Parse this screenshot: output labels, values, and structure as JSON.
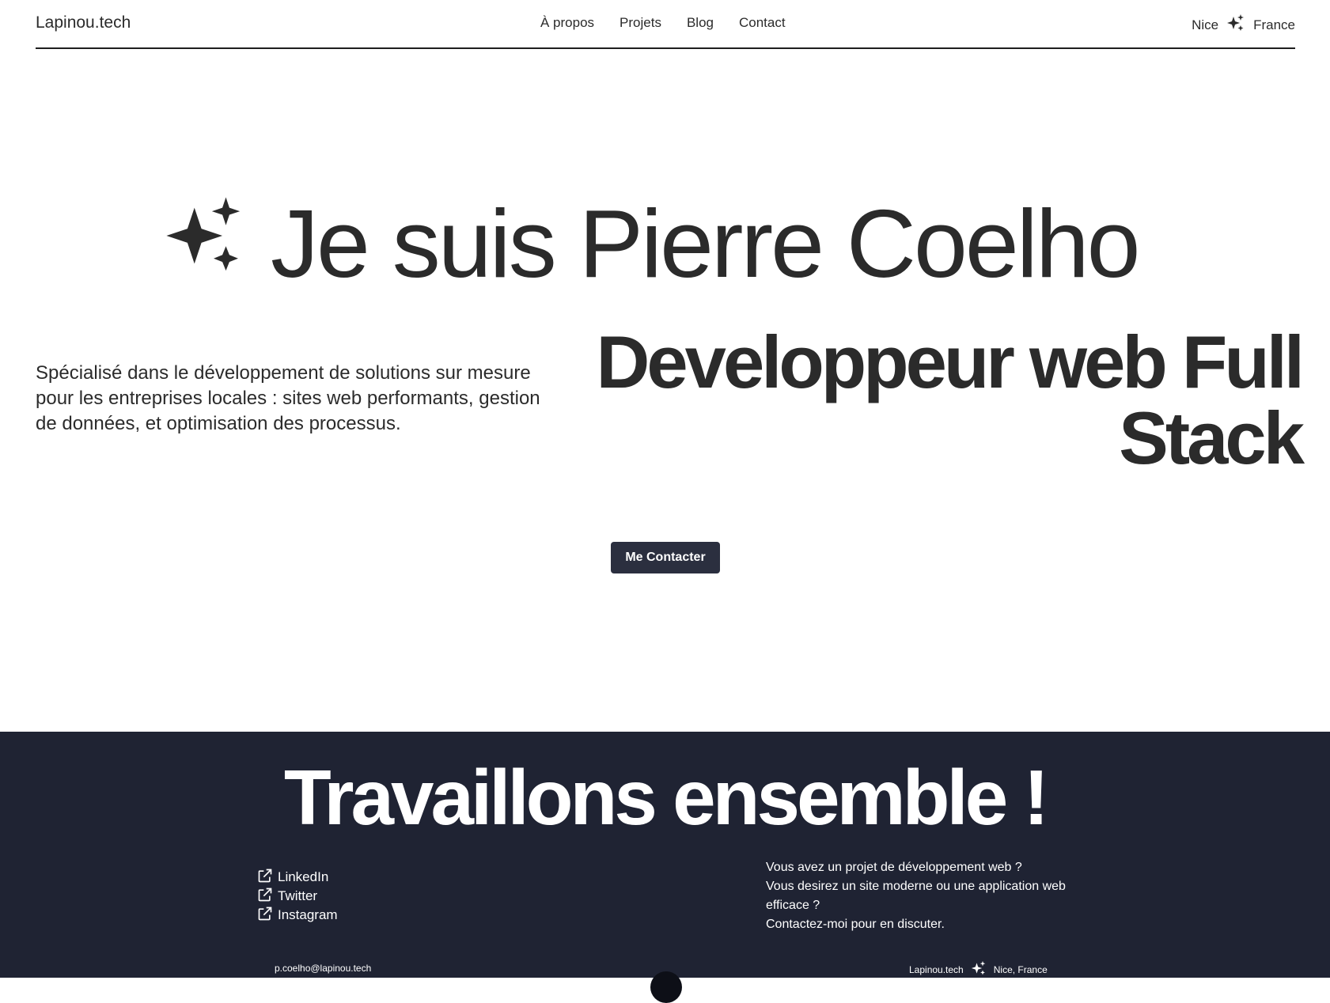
{
  "header": {
    "logo": "Lapinou.tech",
    "nav": [
      "À propos",
      "Projets",
      "Blog",
      "Contact"
    ],
    "location_city": "Nice",
    "location_country": "France"
  },
  "hero": {
    "title": "Je suis Pierre Coelho",
    "role_line1": "Developpeur web Full",
    "role_line2": "Stack",
    "description": "Spécialisé dans le développement de solutions sur mesure pour les entreprises locales : sites web performants, gestion de données, et optimisation des processus.",
    "cta_label": "Me Contacter"
  },
  "footer": {
    "title": "Travaillons ensemble !",
    "social": [
      "LinkedIn",
      "Twitter",
      "Instagram"
    ],
    "message_lines": [
      "Vous avez un projet de développement web ?",
      "Vous desirez un site moderne ou une application web efficace ?",
      "Contactez-moi pour en discuter."
    ],
    "email": "p.coelho@lapinou.tech",
    "brand": "Lapinou.tech",
    "location": "Nice, France"
  },
  "icons": {
    "sparkle": "sparkles-icon",
    "external": "external-link-icon"
  },
  "colors": {
    "text": "#2b2b2b",
    "footer_bg": "#1f2333",
    "button_bg": "#2b2f3f",
    "white": "#ffffff"
  }
}
